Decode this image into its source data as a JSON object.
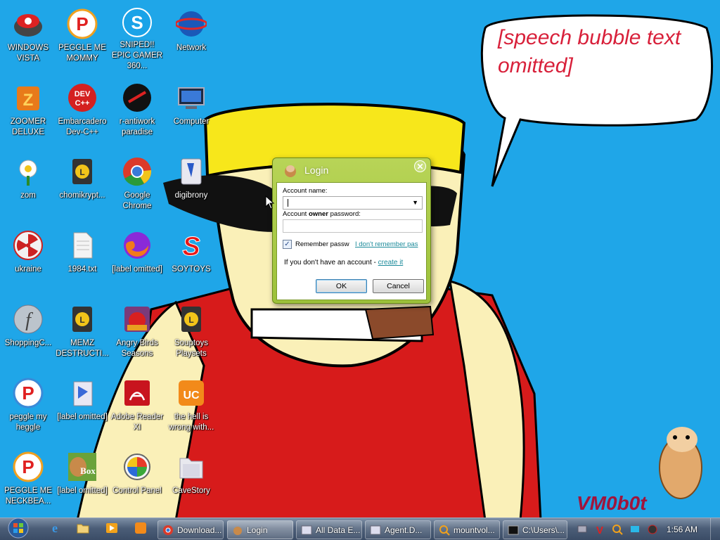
{
  "wallpaper": {
    "speech_bubble_text": "[speech bubble text omitted]",
    "signature": "VM0b0t"
  },
  "desktop_icons": [
    {
      "label": "WINDOWS VISTA",
      "icon": "vista-icon"
    },
    {
      "label": "PEGGLE ME MOMMY",
      "icon": "peggle-icon"
    },
    {
      "label": "SNIPED!! EPIC GAMER 360...",
      "icon": "skype-icon"
    },
    {
      "label": "Network",
      "icon": "network-icon"
    },
    {
      "label": "ZOOMER DELUXE",
      "icon": "zoomer-icon"
    },
    {
      "label": "Embarcadero Dev-C++",
      "icon": "devcpp-icon"
    },
    {
      "label": "r-antiwork paradise",
      "icon": "antiwork-icon"
    },
    {
      "label": "Computer",
      "icon": "computer-icon"
    },
    {
      "label": "zom",
      "icon": "zombie-flower-icon"
    },
    {
      "label": "chomikrypt...",
      "icon": "chomikuj-icon"
    },
    {
      "label": "Google Chrome",
      "icon": "chrome-icon"
    },
    {
      "label": "digibrony",
      "icon": "digibrony-icon"
    },
    {
      "label": "ukraine",
      "icon": "radiation-icon"
    },
    {
      "label": "1984.txt",
      "icon": "text-file-icon"
    },
    {
      "label": "[label omitted]",
      "icon": "firefox-icon"
    },
    {
      "label": "SOYTOYS",
      "icon": "soytoys-icon"
    },
    {
      "label": "ShoppingC...",
      "icon": "flash-icon"
    },
    {
      "label": "MEMZ DESTRUCTI...",
      "icon": "memz-icon"
    },
    {
      "label": "Angry Birds Seasons",
      "icon": "angry-birds-icon"
    },
    {
      "label": "Souptoys Playsets",
      "icon": "souptoys-icon"
    },
    {
      "label": "peggle my heggle",
      "icon": "peggle-icon"
    },
    {
      "label": "[label omitted]",
      "icon": "media-folder-icon"
    },
    {
      "label": "Adobe Reader XI",
      "icon": "adobe-reader-icon"
    },
    {
      "label": "the hell is wrong with...",
      "icon": "uc-browser-icon"
    },
    {
      "label": "PEGGLE ME NECKBEA...",
      "icon": "peggle-icon"
    },
    {
      "label": "[label omitted]",
      "icon": "hamster-box-icon"
    },
    {
      "label": "Control Panel",
      "icon": "control-panel-icon"
    },
    {
      "label": "CaveStory",
      "icon": "folder-icon"
    }
  ],
  "login_dialog": {
    "title": "Login",
    "account_name_label": "Account name:",
    "password_label_prefix": "Account ",
    "password_label_bold": "owner",
    "password_label_suffix": " password:",
    "account_name_value": "",
    "password_value": "",
    "remember_label": "Remember passw",
    "remember_checked": true,
    "forgot_link": "I don't remember pas",
    "signup_prefix": "If you don't have an account - ",
    "signup_link": "create it",
    "ok_label": "OK",
    "cancel_label": "Cancel"
  },
  "taskbar": {
    "tasks": [
      {
        "label": "Download...",
        "icon": "chrome-icon"
      },
      {
        "label": "Login",
        "icon": "hamster-icon"
      },
      {
        "label": "All Data E...",
        "icon": "window-icon"
      },
      {
        "label": "Agent.D...",
        "icon": "window-icon"
      },
      {
        "label": "mountvol...",
        "icon": "magnifier-icon"
      },
      {
        "label": "C:\\Users\\...",
        "icon": "cmd-icon"
      }
    ],
    "clock": "1:56 AM"
  },
  "colors": {
    "desktop_bg": "#1fa6e8",
    "dialog_frame": "#a8cb46",
    "link": "#1b8a9a",
    "bubble_text": "#d8203a"
  }
}
